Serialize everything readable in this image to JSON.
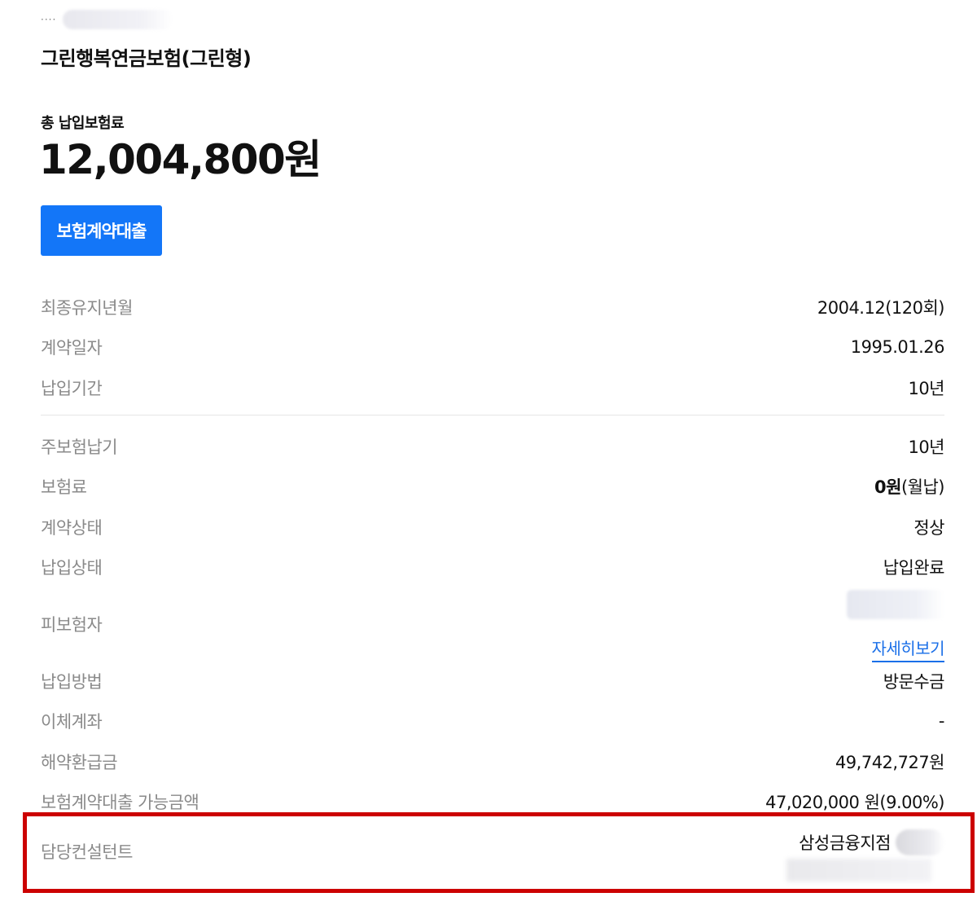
{
  "header": {
    "masked_prefix": "····"
  },
  "product": {
    "name": "그린행복연금보험(그린형)"
  },
  "premium": {
    "label": "총 납입보험료",
    "amount": "12,004,800원"
  },
  "actions": {
    "loan_button_label": "보험계약대출"
  },
  "details_group1": [
    {
      "label": "최종유지년월",
      "value": "2004.12(120회)"
    },
    {
      "label": "계약일자",
      "value": "1995.01.26"
    },
    {
      "label": "납입기간",
      "value": "10년"
    }
  ],
  "details_group2": [
    {
      "label": "주보험납기",
      "value": "10년"
    },
    {
      "label": "보험료",
      "value_bold": "0원",
      "value_suffix": "(월납)"
    },
    {
      "label": "계약상태",
      "value": "정상"
    },
    {
      "label": "납입상태",
      "value": "납입완료"
    }
  ],
  "insured": {
    "label": "피보험자",
    "detail_link": "자세히보기"
  },
  "details_group3": [
    {
      "label": "납입방법",
      "value": "방문수금"
    },
    {
      "label": "이체계좌",
      "value": "-"
    },
    {
      "label": "해약환급금",
      "value": "49,742,727원"
    },
    {
      "label": "보험계약대출 가능금액",
      "value": "47,020,000 원(9.00%)"
    }
  ],
  "consultant": {
    "label": "담당컨설턴트",
    "branch": "삼성금융지점"
  },
  "colors": {
    "primary_button": "#1376f8",
    "link": "#1a6fe8",
    "highlight_border": "#cc0000",
    "label_gray": "#8a8a8a"
  }
}
